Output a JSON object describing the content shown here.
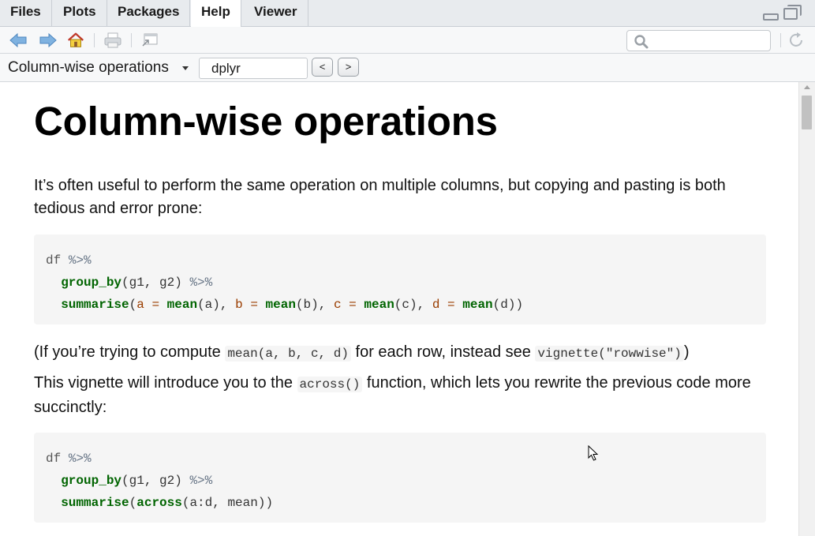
{
  "tabs": [
    {
      "label": "Files"
    },
    {
      "label": "Plots"
    },
    {
      "label": "Packages"
    },
    {
      "label": "Help"
    },
    {
      "label": "Viewer"
    }
  ],
  "active_tab": "Help",
  "toolbar": {
    "search_value": "",
    "search_placeholder": ""
  },
  "topic": {
    "title": "Column-wise operations",
    "package": "dplyr",
    "prev_label": "<",
    "next_label": ">"
  },
  "article": {
    "heading": "Column-wise operations",
    "para1": "It’s often useful to perform the same operation on multiple columns, but copying and pasting is both tedious and error prone:",
    "code1": {
      "line1_a": "df",
      "line1_b": "%>%",
      "line2_fn": "group_by",
      "line2_args": "(g1, g2)",
      "line2_op": "%>%",
      "line3_fn": "summarise",
      "line3_p1": "(",
      "line3_a": "a",
      "line3_eq": "=",
      "line3_mean": "mean",
      "line3_aarg": "(a), ",
      "line3_b": "b",
      "line3_barg": "(b), ",
      "line3_c": "c",
      "line3_carg": "(c), ",
      "line3_d": "d",
      "line3_darg": "(d))"
    },
    "para2_a": "(If you’re trying to compute ",
    "para2_code1": "mean(a, b, c, d)",
    "para2_b": " for each row, instead see ",
    "para2_code2": "vignette(\"rowwise\")",
    "para2_c": ")",
    "para3_a": "This vignette will introduce you to the ",
    "para3_code": "across()",
    "para3_b": " function, which lets you rewrite the previous code more succinctly:",
    "code2": {
      "line1_a": "df",
      "line1_b": "%>%",
      "line2_fn": "group_by",
      "line2_args": "(g1, g2)",
      "line2_op": "%>%",
      "line3_fn": "summarise",
      "line3_p1": "(",
      "line3_across": "across",
      "line3_args": "(a:d, mean))"
    }
  },
  "colors": {
    "code_function": "#006400",
    "code_background": "#f5f5f5",
    "tabbar_background": "#e8ebee"
  }
}
